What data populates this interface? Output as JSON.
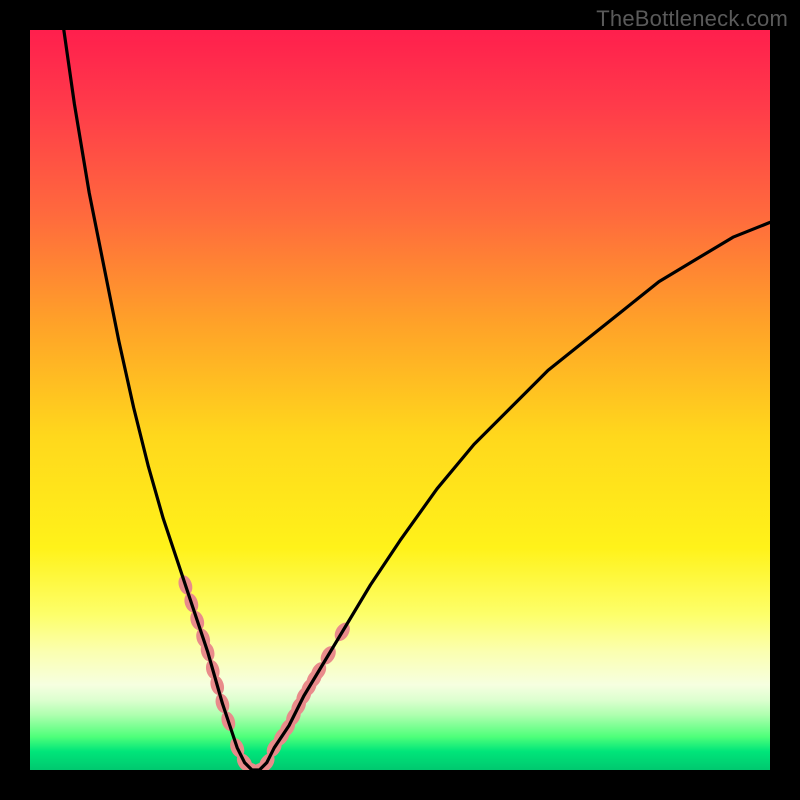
{
  "watermark": "TheBottleneck.com",
  "colors": {
    "frame": "#000000",
    "curve": "#000000",
    "blob": "#e98b8b",
    "gradientStops": [
      {
        "offset": 0.0,
        "color": "#ff1f4d"
      },
      {
        "offset": 0.1,
        "color": "#ff3a4a"
      },
      {
        "offset": 0.25,
        "color": "#ff6a3d"
      },
      {
        "offset": 0.4,
        "color": "#ffa328"
      },
      {
        "offset": 0.55,
        "color": "#ffd81c"
      },
      {
        "offset": 0.7,
        "color": "#fff21a"
      },
      {
        "offset": 0.79,
        "color": "#fdff6a"
      },
      {
        "offset": 0.84,
        "color": "#fbffb0"
      },
      {
        "offset": 0.885,
        "color": "#f6ffe0"
      },
      {
        "offset": 0.905,
        "color": "#ddffd0"
      },
      {
        "offset": 0.925,
        "color": "#b0ffb0"
      },
      {
        "offset": 0.955,
        "color": "#4fff7a"
      },
      {
        "offset": 0.975,
        "color": "#00e57a"
      },
      {
        "offset": 1.0,
        "color": "#00c86f"
      }
    ]
  },
  "chart_data": {
    "type": "line",
    "title": "",
    "xlabel": "",
    "ylabel": "",
    "xlim": [
      0,
      100
    ],
    "ylim": [
      0,
      100
    ],
    "x": [
      0,
      2,
      4,
      6,
      8,
      10,
      12,
      14,
      16,
      18,
      20,
      22,
      24,
      26,
      27,
      28,
      29,
      30,
      31,
      32,
      33,
      35,
      37,
      40,
      43,
      46,
      50,
      55,
      60,
      65,
      70,
      75,
      80,
      85,
      90,
      95,
      100
    ],
    "y": [
      138,
      120,
      104,
      90,
      78,
      68,
      58,
      49,
      41,
      34,
      28,
      22,
      16,
      9,
      6,
      3,
      1,
      0,
      0,
      1,
      3,
      6,
      10,
      15,
      20,
      25,
      31,
      38,
      44,
      49,
      54,
      58,
      62,
      66,
      69,
      72,
      74
    ],
    "note": "y values beyond 100 are clipped by the plot area; curve minimum (approx 0%) occurs near x≈30. Left branch descends from top edge; right branch rises toward ~74% at right edge.",
    "blobs_x": [
      21.0,
      21.8,
      22.6,
      23.4,
      24.0,
      24.7,
      25.3,
      26.0,
      26.8,
      28.0,
      29.0,
      30.0,
      31.0,
      32.0,
      33.0,
      34.0,
      34.8,
      35.6,
      36.3,
      37.0,
      37.7,
      38.4,
      39.0,
      40.3,
      42.2
    ],
    "blobs_note": "Approximate x positions (in x-axis units 0–100) of the salmon-colored bead markers clustered along both branches near the bottom. Their y positions lie on the curve."
  }
}
